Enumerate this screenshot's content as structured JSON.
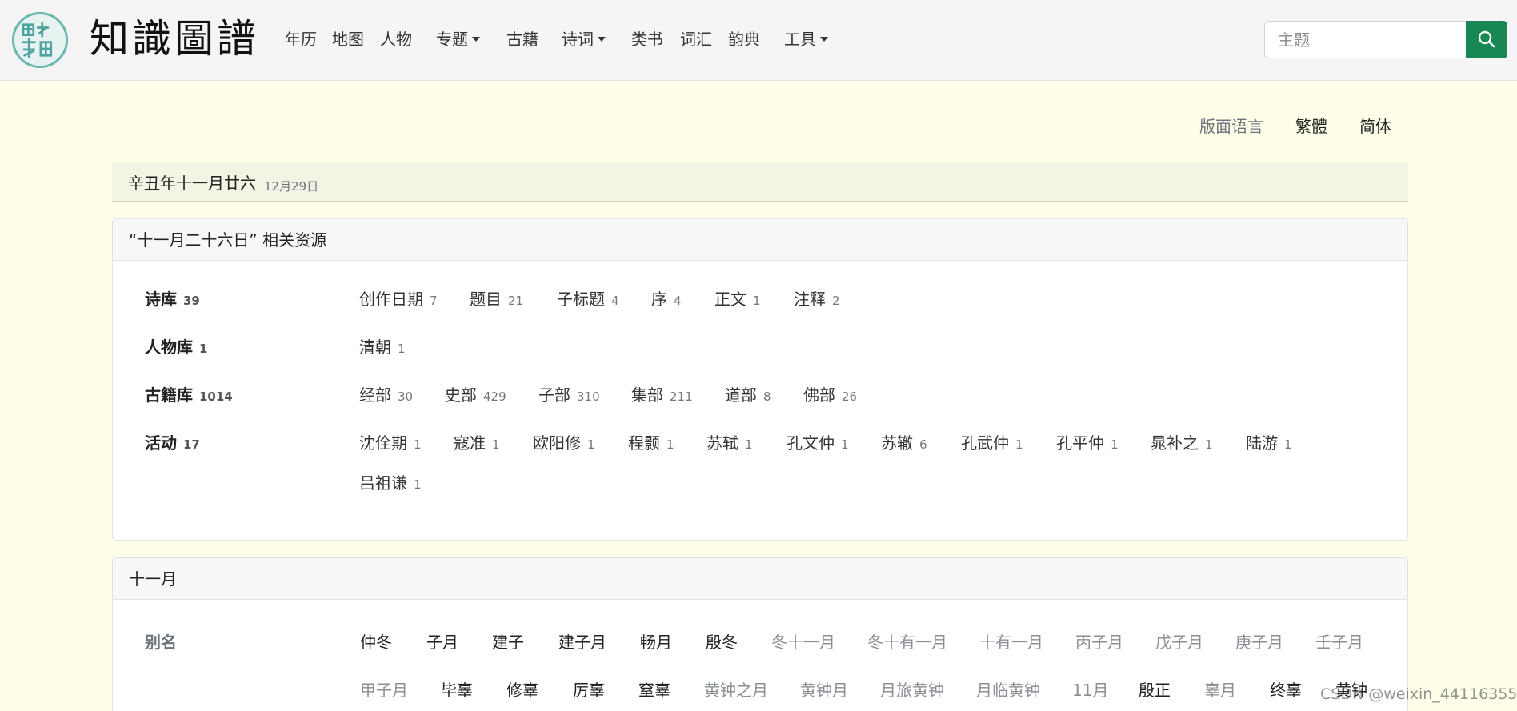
{
  "navbar": {
    "brand": "知識圖譜",
    "items": [
      {
        "label": "年历",
        "dropdown": false
      },
      {
        "label": "地图",
        "dropdown": false
      },
      {
        "label": "人物",
        "dropdown": false
      },
      {
        "label": "专题",
        "dropdown": true
      },
      {
        "label": "古籍",
        "dropdown": false
      },
      {
        "label": "诗词",
        "dropdown": true
      },
      {
        "label": "类书",
        "dropdown": false
      },
      {
        "label": "词汇",
        "dropdown": false
      },
      {
        "label": "韵典",
        "dropdown": false
      },
      {
        "label": "工具",
        "dropdown": true
      }
    ],
    "search_placeholder": "主题",
    "accent": "#198754"
  },
  "language": {
    "label": "版面语言",
    "options": [
      "繁體",
      "简体"
    ]
  },
  "date": {
    "lunar": "辛丑年十一月廿六",
    "solar": "12月29日"
  },
  "resources": {
    "header": "“十一月二十六日” 相关资源",
    "rows": [
      {
        "label": "诗库",
        "count": "39",
        "items": [
          {
            "name": "创作日期",
            "count": "7"
          },
          {
            "name": "题目",
            "count": "21"
          },
          {
            "name": "子标题",
            "count": "4"
          },
          {
            "name": "序",
            "count": "4"
          },
          {
            "name": "正文",
            "count": "1"
          },
          {
            "name": "注释",
            "count": "2"
          }
        ]
      },
      {
        "label": "人物库",
        "count": "1",
        "items": [
          {
            "name": "清朝",
            "count": "1"
          }
        ]
      },
      {
        "label": "古籍库",
        "count": "1014",
        "items": [
          {
            "name": "经部",
            "count": "30"
          },
          {
            "name": "史部",
            "count": "429"
          },
          {
            "name": "子部",
            "count": "310"
          },
          {
            "name": "集部",
            "count": "211"
          },
          {
            "name": "道部",
            "count": "8"
          },
          {
            "name": "佛部",
            "count": "26"
          }
        ]
      },
      {
        "label": "活动",
        "count": "17",
        "items": [
          {
            "name": "沈佺期",
            "count": "1"
          },
          {
            "name": "寇准",
            "count": "1"
          },
          {
            "name": "欧阳修",
            "count": "1"
          },
          {
            "name": "程颢",
            "count": "1"
          },
          {
            "name": "苏轼",
            "count": "1"
          },
          {
            "name": "孔文仲",
            "count": "1"
          },
          {
            "name": "苏辙",
            "count": "6"
          },
          {
            "name": "孔武仲",
            "count": "1"
          },
          {
            "name": "孔平仲",
            "count": "1"
          },
          {
            "name": "晁补之",
            "count": "1"
          },
          {
            "name": "陆游",
            "count": "1"
          },
          {
            "name": "吕祖谦",
            "count": "1"
          }
        ]
      }
    ]
  },
  "month": {
    "header": "十一月",
    "alias_label": "别名",
    "aliases_row1": [
      {
        "name": "仲冬",
        "style": "dark"
      },
      {
        "name": "子月",
        "style": "dark"
      },
      {
        "name": "建子",
        "style": "dark"
      },
      {
        "name": "建子月",
        "style": "dark"
      },
      {
        "name": "畅月",
        "style": "dark"
      },
      {
        "name": "殷冬",
        "style": "dark"
      },
      {
        "name": "冬十一月",
        "style": "muted"
      },
      {
        "name": "冬十有一月",
        "style": "muted"
      },
      {
        "name": "十有一月",
        "style": "muted"
      },
      {
        "name": "丙子月",
        "style": "muted"
      },
      {
        "name": "戊子月",
        "style": "muted"
      },
      {
        "name": "庚子月",
        "style": "muted"
      },
      {
        "name": "壬子月",
        "style": "muted"
      }
    ],
    "aliases_row2": [
      {
        "name": "甲子月",
        "style": "muted"
      },
      {
        "name": "毕辜",
        "style": "dark"
      },
      {
        "name": "修辜",
        "style": "dark"
      },
      {
        "name": "厉辜",
        "style": "dark"
      },
      {
        "name": "窒辜",
        "style": "dark"
      },
      {
        "name": "黄钟之月",
        "style": "muted"
      },
      {
        "name": "黄钟月",
        "style": "muted"
      },
      {
        "name": "月旅黄钟",
        "style": "muted"
      },
      {
        "name": "月临黄钟",
        "style": "muted"
      },
      {
        "name": "11月",
        "style": "muted"
      },
      {
        "name": "殷正",
        "style": "dark"
      },
      {
        "name": "辜月",
        "style": "muted"
      },
      {
        "name": "终辜",
        "style": "dark"
      },
      {
        "name": "黄钟",
        "style": "dark"
      }
    ]
  },
  "watermark": "CSDN @weixin_44116355"
}
